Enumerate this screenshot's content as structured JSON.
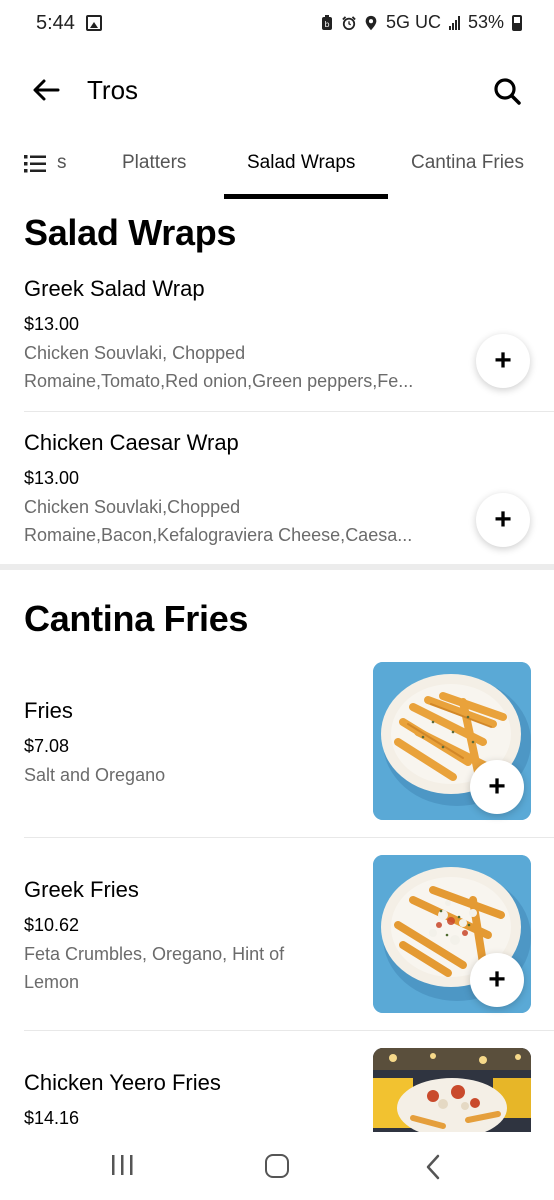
{
  "status_bar": {
    "time": "5:44",
    "network": "5G UC",
    "battery": "53%"
  },
  "header": {
    "title": "Tros"
  },
  "tabs": [
    {
      "label": "s"
    },
    {
      "label": "Platters"
    },
    {
      "label": "Salad Wraps"
    },
    {
      "label": "Cantina Fries"
    }
  ],
  "sections": {
    "salad_wraps": {
      "title": "Salad Wraps",
      "items": [
        {
          "name": "Greek Salad Wrap",
          "price": "$13.00",
          "desc_line1": "Chicken Souvlaki, Chopped",
          "desc_line2": "Romaine,Tomato,Red onion,Green peppers,Fe..."
        },
        {
          "name": "Chicken Caesar Wrap",
          "price": "$13.00",
          "desc_line1": "Chicken Souvlaki,Chopped",
          "desc_line2": "Romaine,Bacon,Kefalograviera Cheese,Caesa..."
        }
      ]
    },
    "cantina_fries": {
      "title": "Cantina Fries",
      "items": [
        {
          "name": "Fries",
          "price": "$7.08",
          "desc_line1": "Salt and Oregano",
          "desc_line2": ""
        },
        {
          "name": "Greek Fries",
          "price": "$10.62",
          "desc_line1": "Feta Crumbles, Oregano, Hint of",
          "desc_line2": "Lemon"
        },
        {
          "name": "Chicken Yeero Fries",
          "price": "$14.16",
          "desc_line1": "",
          "desc_line2": ""
        }
      ]
    }
  },
  "add_label": "+",
  "colors": {
    "text_primary": "#000000",
    "text_secondary": "#6b6b6b",
    "divider": "#ececec",
    "image_bg": "#5aa9d6"
  }
}
